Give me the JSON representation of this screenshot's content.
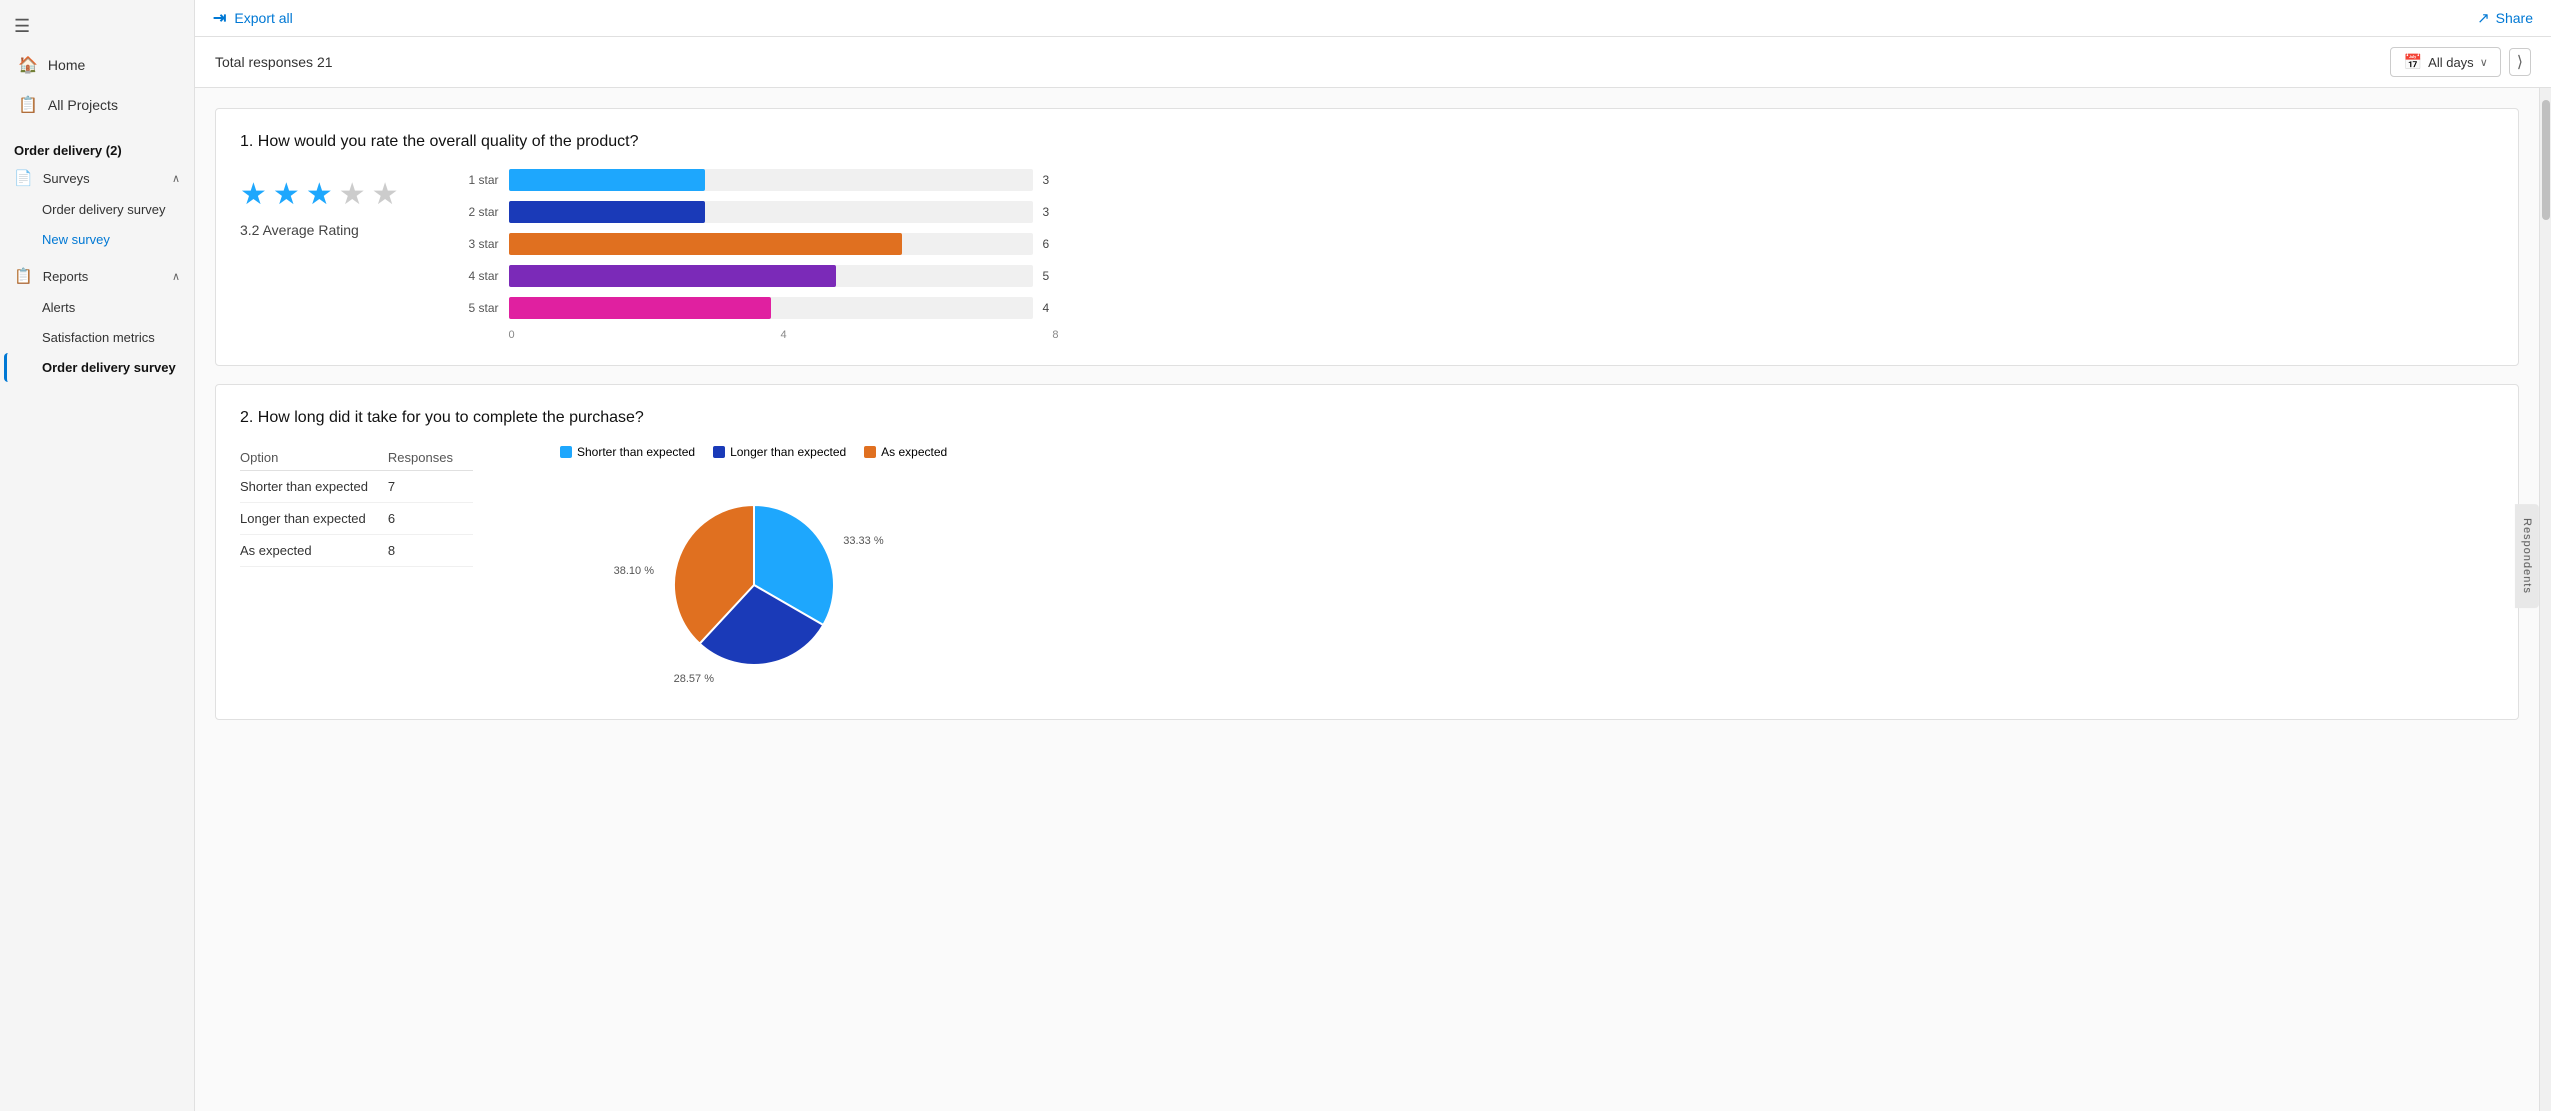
{
  "sidebar": {
    "menu_icon": "☰",
    "items": [
      {
        "id": "home",
        "label": "Home",
        "icon": "🏠"
      },
      {
        "id": "all-projects",
        "label": "All Projects",
        "icon": "📄"
      }
    ],
    "section_title": "Order delivery (2)",
    "surveys_label": "Surveys",
    "surveys_items": [
      {
        "id": "order-delivery-survey",
        "label": "Order delivery survey"
      },
      {
        "id": "new-survey",
        "label": "New survey",
        "active": "blue"
      }
    ],
    "reports_label": "Reports",
    "reports_items": [
      {
        "id": "alerts",
        "label": "Alerts"
      },
      {
        "id": "satisfaction-metrics",
        "label": "Satisfaction metrics"
      },
      {
        "id": "order-delivery-survey-report",
        "label": "Order delivery survey",
        "active": "selected"
      }
    ]
  },
  "toolbar": {
    "export_label": "Export all",
    "share_label": "Share",
    "export_icon": "→",
    "share_icon": "↗"
  },
  "stats": {
    "total_label": "Total responses 21",
    "filter_label": "All days",
    "calendar_icon": "📅"
  },
  "questions": [
    {
      "id": "q1",
      "number": "1.",
      "text": "How would you rate the overall quality of the product?",
      "type": "star_rating",
      "average": 3.2,
      "average_label": "3.2 Average Rating",
      "filled_stars": 3,
      "total_stars": 5,
      "bars": [
        {
          "label": "1 star",
          "value": 3,
          "max": 8,
          "color": "#1ea7fd"
        },
        {
          "label": "2 star",
          "value": 3,
          "max": 8,
          "color": "#1a3ab8"
        },
        {
          "label": "3 star",
          "value": 6,
          "max": 8,
          "color": "#e07020"
        },
        {
          "label": "4 star",
          "value": 5,
          "max": 8,
          "color": "#7b2ab8"
        },
        {
          "label": "5 star",
          "value": 4,
          "max": 8,
          "color": "#e020a0"
        }
      ],
      "axis_labels": [
        "0",
        "4",
        "8"
      ]
    },
    {
      "id": "q2",
      "number": "2.",
      "text": "How long did it take for you to complete the purchase?",
      "type": "pie_chart",
      "table": {
        "headers": [
          "Option",
          "Responses"
        ],
        "rows": [
          {
            "option": "Shorter than expected",
            "responses": 7
          },
          {
            "option": "Longer than expected",
            "responses": 6
          },
          {
            "option": "As expected",
            "responses": 8
          }
        ]
      },
      "pie": {
        "segments": [
          {
            "label": "Shorter than expected",
            "value": 33.33,
            "color": "#1ea7fd",
            "percent": "33.33 %"
          },
          {
            "label": "Longer than expected",
            "value": 28.57,
            "color": "#1a3ab8",
            "percent": "28.57 %"
          },
          {
            "label": "As expected",
            "value": 38.1,
            "color": "#e07020",
            "percent": "38.10 %"
          }
        ]
      }
    }
  ],
  "respondents_tab": "Respondents",
  "close_icon": "✕",
  "chevron_down_icon": "∨",
  "collapse_icon": "⟩"
}
